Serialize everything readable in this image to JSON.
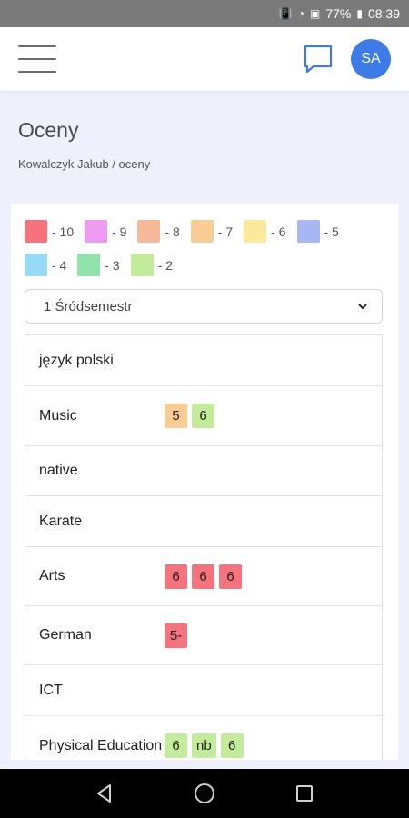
{
  "status_bar": {
    "battery": "77%",
    "time": "08:39"
  },
  "header": {
    "avatar_initials": "SA"
  },
  "page": {
    "title": "Oceny",
    "breadcrumb": "Kowalczyk Jakub / oceny"
  },
  "legend": [
    {
      "label": "- 10",
      "color": "#f5737c"
    },
    {
      "label": "- 9",
      "color": "#ee9af0"
    },
    {
      "label": "- 8",
      "color": "#f7b99a"
    },
    {
      "label": "- 7",
      "color": "#f9cc93"
    },
    {
      "label": "- 6",
      "color": "#fbe99c"
    },
    {
      "label": "- 5",
      "color": "#a7b7f2"
    },
    {
      "label": "- 4",
      "color": "#97d9f6"
    },
    {
      "label": "- 3",
      "color": "#91e1aa"
    },
    {
      "label": "- 2",
      "color": "#c3ec9a"
    }
  ],
  "term_select": {
    "value": "1 Śródsemestr"
  },
  "subjects": [
    {
      "name": "język polski",
      "grades": []
    },
    {
      "name": "Music",
      "grades": [
        {
          "value": "5",
          "color": "#f9cc93"
        },
        {
          "value": "6",
          "color": "#c3ec9a"
        }
      ]
    },
    {
      "name": "native",
      "grades": []
    },
    {
      "name": "Karate",
      "grades": []
    },
    {
      "name": "Arts",
      "grades": [
        {
          "value": "6",
          "color": "#f5737c"
        },
        {
          "value": "6",
          "color": "#f5737c"
        },
        {
          "value": "6",
          "color": "#f5737c"
        }
      ]
    },
    {
      "name": "German",
      "grades": [
        {
          "value": "5-",
          "color": "#f5737c"
        }
      ]
    },
    {
      "name": "ICT",
      "grades": []
    },
    {
      "name": "Physical Education",
      "grades": [
        {
          "value": "6",
          "color": "#c3ec9a"
        },
        {
          "value": "nb",
          "color": "#c3ec9a"
        },
        {
          "value": "6",
          "color": "#c3ec9a"
        }
      ]
    }
  ]
}
